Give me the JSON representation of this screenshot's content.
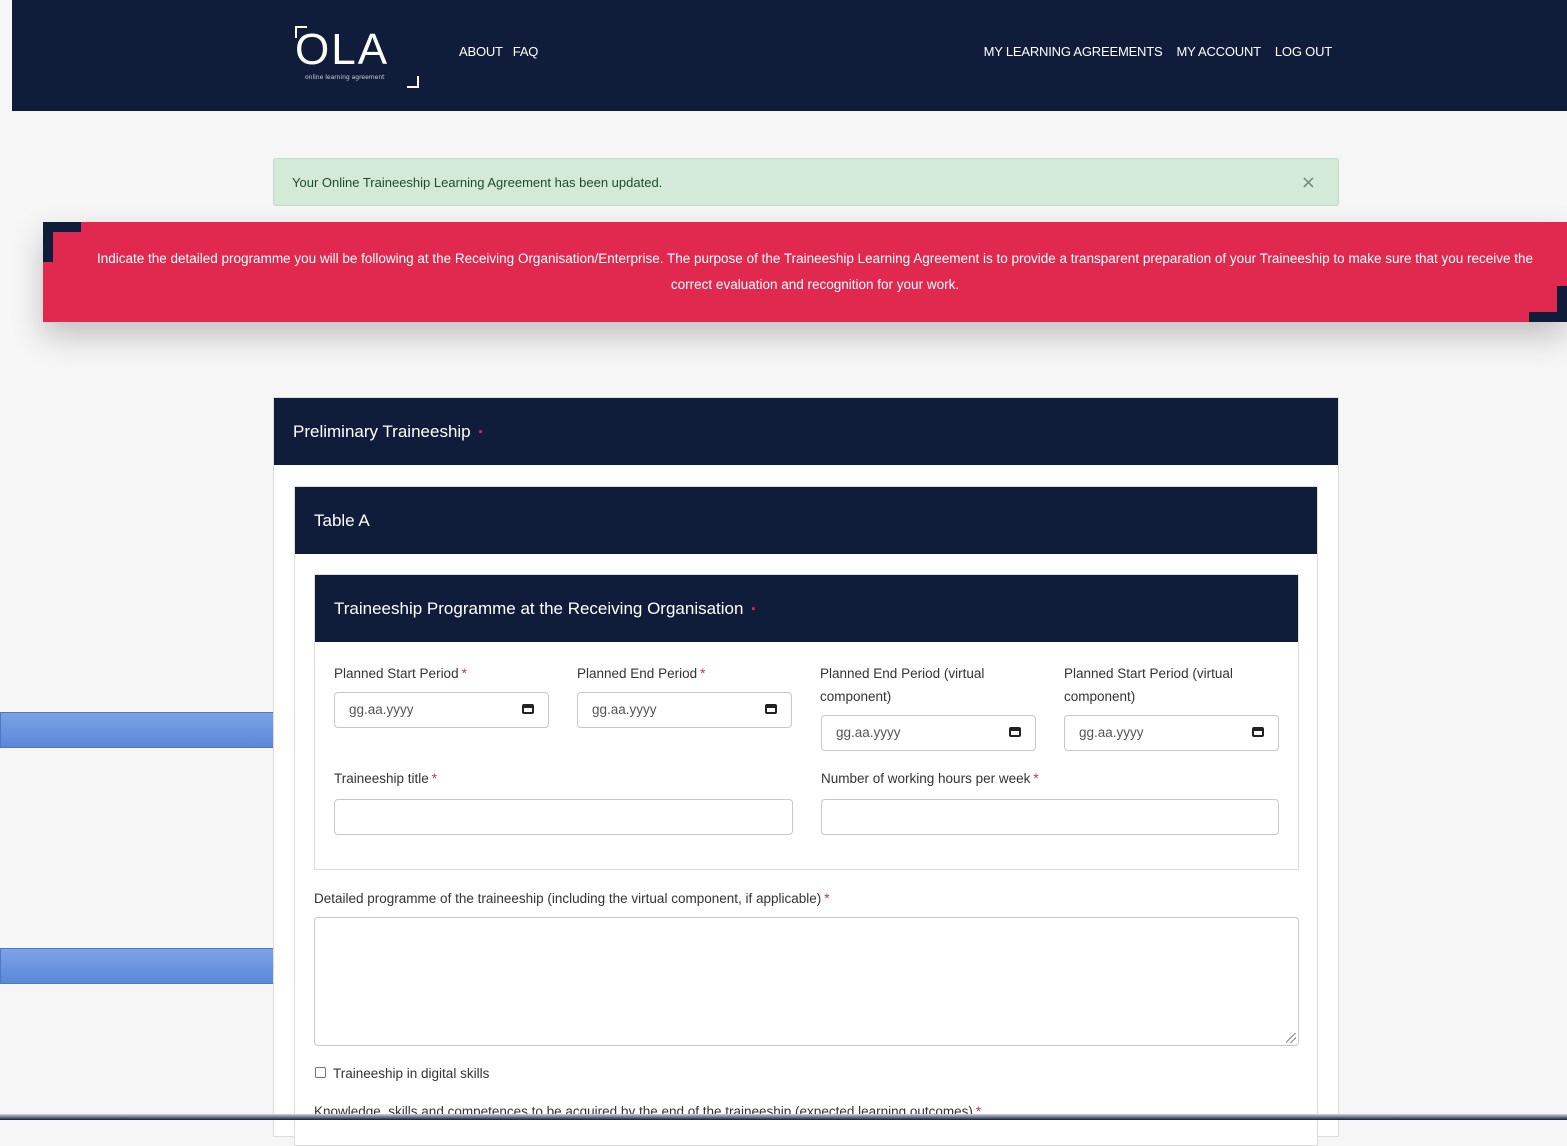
{
  "header": {
    "logo_text": "OLA",
    "logo_subtext": "online learning agreement",
    "nav_left": [
      "ABOUT",
      "FAQ"
    ],
    "nav_right": [
      "MY LEARNING AGREEMENTS",
      "MY ACCOUNT",
      "LOG OUT"
    ]
  },
  "alert": {
    "message": "Your Online Traineeship Learning Agreement has been updated.",
    "close_glyph": "×"
  },
  "banner": {
    "text": "Indicate the detailed programme you will be following at the Receiving Organisation/Enterprise. The purpose of the Traineeship Learning Agreement is to provide a transparent preparation of your Traineeship to make sure that you receive the correct evaluation and recognition for your work."
  },
  "section": {
    "title": "Preliminary Traineeship",
    "required_mark": "▪",
    "table_title": "Table A",
    "programme": {
      "title": "Traineeship Programme at the Receiving Organisation",
      "required_mark": "▪",
      "star": "*",
      "planned_start_label": "Planned Start Period",
      "planned_end_label": "Planned End Period",
      "planned_end_virtual_label_1": "Planned End Period (virtual",
      "planned_end_virtual_label_2": "component)",
      "planned_start_virtual_label_1": "Planned Start Period (virtual",
      "planned_start_virtual_label_2": "component)",
      "date_placeholder": "gg.aa.yyyy",
      "title_label": "Traineeship title",
      "hours_label": "Number of working hours per week"
    },
    "detailed_label": "Detailed programme of the traineeship (including the virtual component, if applicable)",
    "digital_skills_label": "Traineeship in digital skills",
    "knowledge_label": "Knowledge, skills and competences to be acquired by the end of the traineeship (expected learning outcomes)"
  }
}
